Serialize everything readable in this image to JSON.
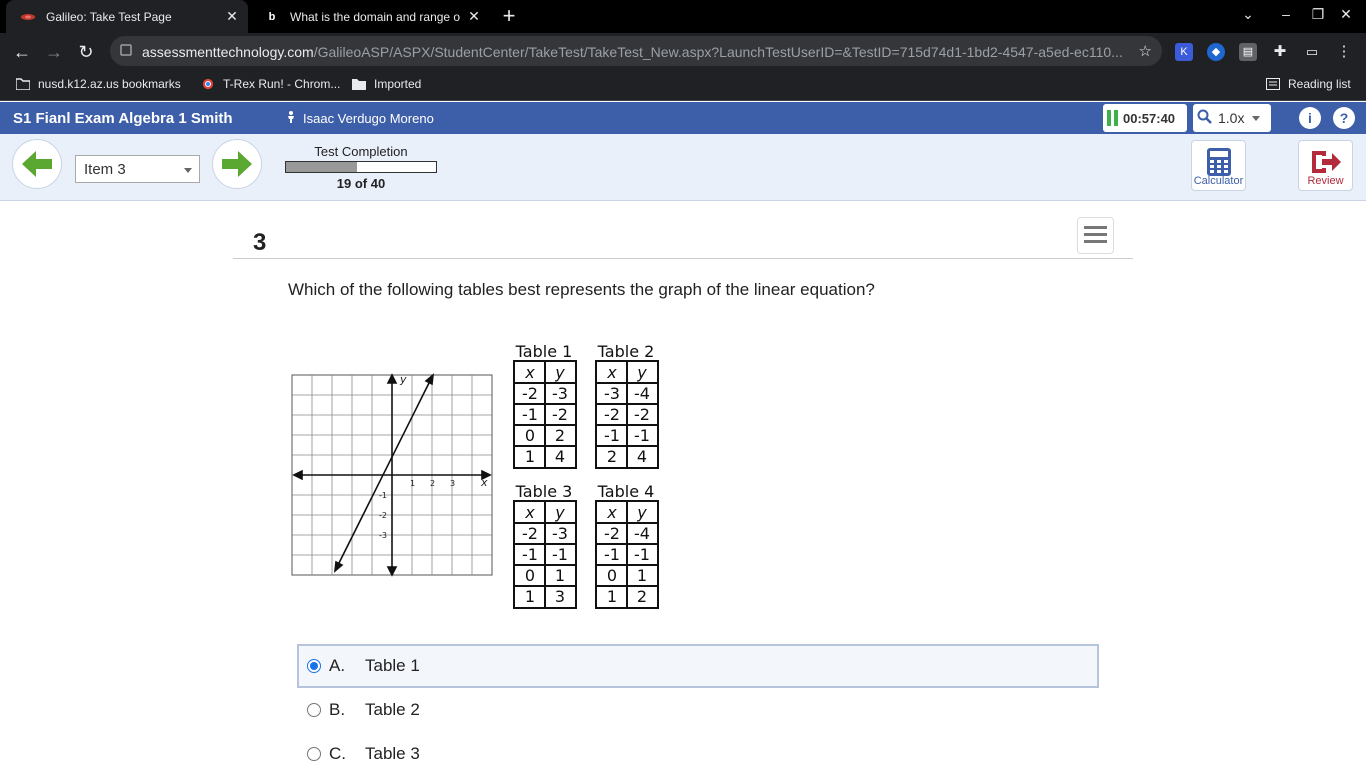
{
  "browser": {
    "tabs": [
      {
        "title": "Galileo: Take Test Page",
        "active": true
      },
      {
        "title": "What is the domain and range o",
        "active": false
      }
    ],
    "url_host": "assessmenttechnology.com",
    "url_path": "/GalileoASP/ASPX/StudentCenter/TakeTest/TakeTest_New.aspx?LaunchTestUserID=&TestID=715d74d1-1bd2-4547-a5ed-ec110...",
    "bookmarks": [
      "nusd.k12.az.us bookmarks",
      "T-Rex Run! - Chrom...",
      "Imported"
    ],
    "reading_list": "Reading list"
  },
  "app": {
    "title": "S1 Fianl Exam Algebra 1 Smith",
    "user": "Isaac Verdugo Moreno",
    "timer": "00:57:40",
    "zoom": "1.0x",
    "info_label": "i",
    "help_label": "?"
  },
  "nav": {
    "item_select": "Item 3",
    "completion_label": "Test Completion",
    "completion_count": "19 of 40",
    "completion_fraction": 0.475,
    "calculator_label": "Calculator",
    "review_label": "Review"
  },
  "question": {
    "number": "3",
    "text": "Which of the following tables best represents the graph of the linear equation?",
    "graph": {
      "x_label": "x",
      "y_label": "y",
      "x_ticks": [
        "1",
        "2",
        "3"
      ],
      "y_ticks": [
        "-1",
        "-2",
        "-3"
      ]
    },
    "tables": [
      {
        "name": "Table 1",
        "header": [
          "x",
          "y"
        ],
        "rows": [
          [
            "-2",
            "-3"
          ],
          [
            "-1",
            "-2"
          ],
          [
            "0",
            "2"
          ],
          [
            "1",
            "4"
          ]
        ]
      },
      {
        "name": "Table 2",
        "header": [
          "x",
          "y"
        ],
        "rows": [
          [
            "-3",
            "-4"
          ],
          [
            "-2",
            "-2"
          ],
          [
            "-1",
            "-1"
          ],
          [
            "2",
            "4"
          ]
        ]
      },
      {
        "name": "Table 3",
        "header": [
          "x",
          "y"
        ],
        "rows": [
          [
            "-2",
            "-3"
          ],
          [
            "-1",
            "-1"
          ],
          [
            "0",
            "1"
          ],
          [
            "1",
            "3"
          ]
        ]
      },
      {
        "name": "Table 4",
        "header": [
          "x",
          "y"
        ],
        "rows": [
          [
            "-2",
            "-4"
          ],
          [
            "-1",
            "-1"
          ],
          [
            "0",
            "1"
          ],
          [
            "1",
            "2"
          ]
        ]
      }
    ],
    "answers": [
      {
        "letter": "A.",
        "text": "Table 1",
        "selected": true
      },
      {
        "letter": "B.",
        "text": "Table 2",
        "selected": false
      },
      {
        "letter": "C.",
        "text": "Table 3",
        "selected": false
      }
    ]
  }
}
